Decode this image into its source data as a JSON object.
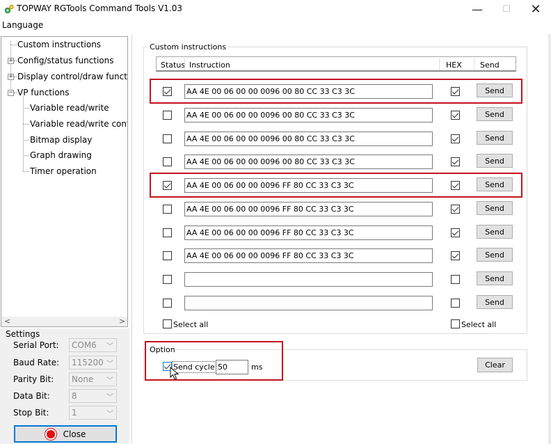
{
  "window": {
    "title": "TOPWAY RGTools Command Tools V1.03",
    "minimize_glyph": "—",
    "maximize_glyph": "☐",
    "close_glyph": "✕"
  },
  "menu": {
    "language": "Language"
  },
  "tree": {
    "items": [
      {
        "label": "Custom instructions"
      },
      {
        "label": "Config/status functions",
        "expander": "+"
      },
      {
        "label": "Display control/draw functions",
        "expander": "+"
      },
      {
        "label": "VP functions",
        "expander": "−"
      },
      {
        "label": "Variable read/write"
      },
      {
        "label": "Variable read/write continu"
      },
      {
        "label": "Bitmap display"
      },
      {
        "label": "Graph drawing"
      },
      {
        "label": "Timer operation"
      }
    ],
    "scroll_left": "<",
    "scroll_right": ">"
  },
  "settings": {
    "title": "Settings",
    "serial_port": {
      "label": "Serial Port:",
      "value": "COM6"
    },
    "baud_rate": {
      "label": "Baud Rate:",
      "value": "115200"
    },
    "parity_bit": {
      "label": "Parity Bit:",
      "value": "None"
    },
    "data_bit": {
      "label": "Data Bit:",
      "value": "8"
    },
    "stop_bit": {
      "label": "Stop Bit:",
      "value": "1"
    },
    "close_label": "Close"
  },
  "custom": {
    "group_title": "Custom instructions",
    "headers": {
      "status": "Status",
      "instruction": "Instruction",
      "hex": "HEX",
      "send": "Send"
    },
    "rows": [
      {
        "status": true,
        "instruction": "AA 4E 00 06 00 00 0096 00 80 CC 33 C3 3C",
        "hex": true,
        "send_label": "Send"
      },
      {
        "status": false,
        "instruction": "AA 4E 00 06 00 00 0096 00 80 CC 33 C3 3C",
        "hex": true,
        "send_label": "Send"
      },
      {
        "status": false,
        "instruction": "AA 4E 00 06 00 00 0096 00 80 CC 33 C3 3C",
        "hex": true,
        "send_label": "Send"
      },
      {
        "status": false,
        "instruction": "AA 4E 00 06 00 00 0096 00 80 CC 33 C3 3C",
        "hex": true,
        "send_label": "Send"
      },
      {
        "status": true,
        "instruction": "AA 4E 00 06 00 00 0096 FF 80 CC 33 C3 3C",
        "hex": true,
        "send_label": "Send"
      },
      {
        "status": false,
        "instruction": "AA 4E 00 06 00 00 0096 FF 80 CC 33 C3 3C",
        "hex": true,
        "send_label": "Send"
      },
      {
        "status": false,
        "instruction": "AA 4E 00 06 00 00 0096 FF 80 CC 33 C3 3C",
        "hex": true,
        "send_label": "Send"
      },
      {
        "status": false,
        "instruction": "AA 4E 00 06 00 00 0096 FF 80 CC 33 C3 3C",
        "hex": true,
        "send_label": "Send"
      },
      {
        "status": false,
        "instruction": "",
        "hex": false,
        "send_label": "Send"
      },
      {
        "status": false,
        "instruction": "",
        "hex": false,
        "send_label": "Send"
      }
    ],
    "select_all_status": "Select all",
    "select_all_hex": "Select all"
  },
  "option": {
    "group_title": "Option",
    "send_cycle_label": "Send cycle",
    "send_cycle_checked": true,
    "cycle_value": "50",
    "unit": "ms",
    "clear_label": "Clear"
  },
  "colors": {
    "highlight_red": "#c3121e",
    "focus_blue": "#0078d7",
    "close_indicator": "#e01010"
  }
}
